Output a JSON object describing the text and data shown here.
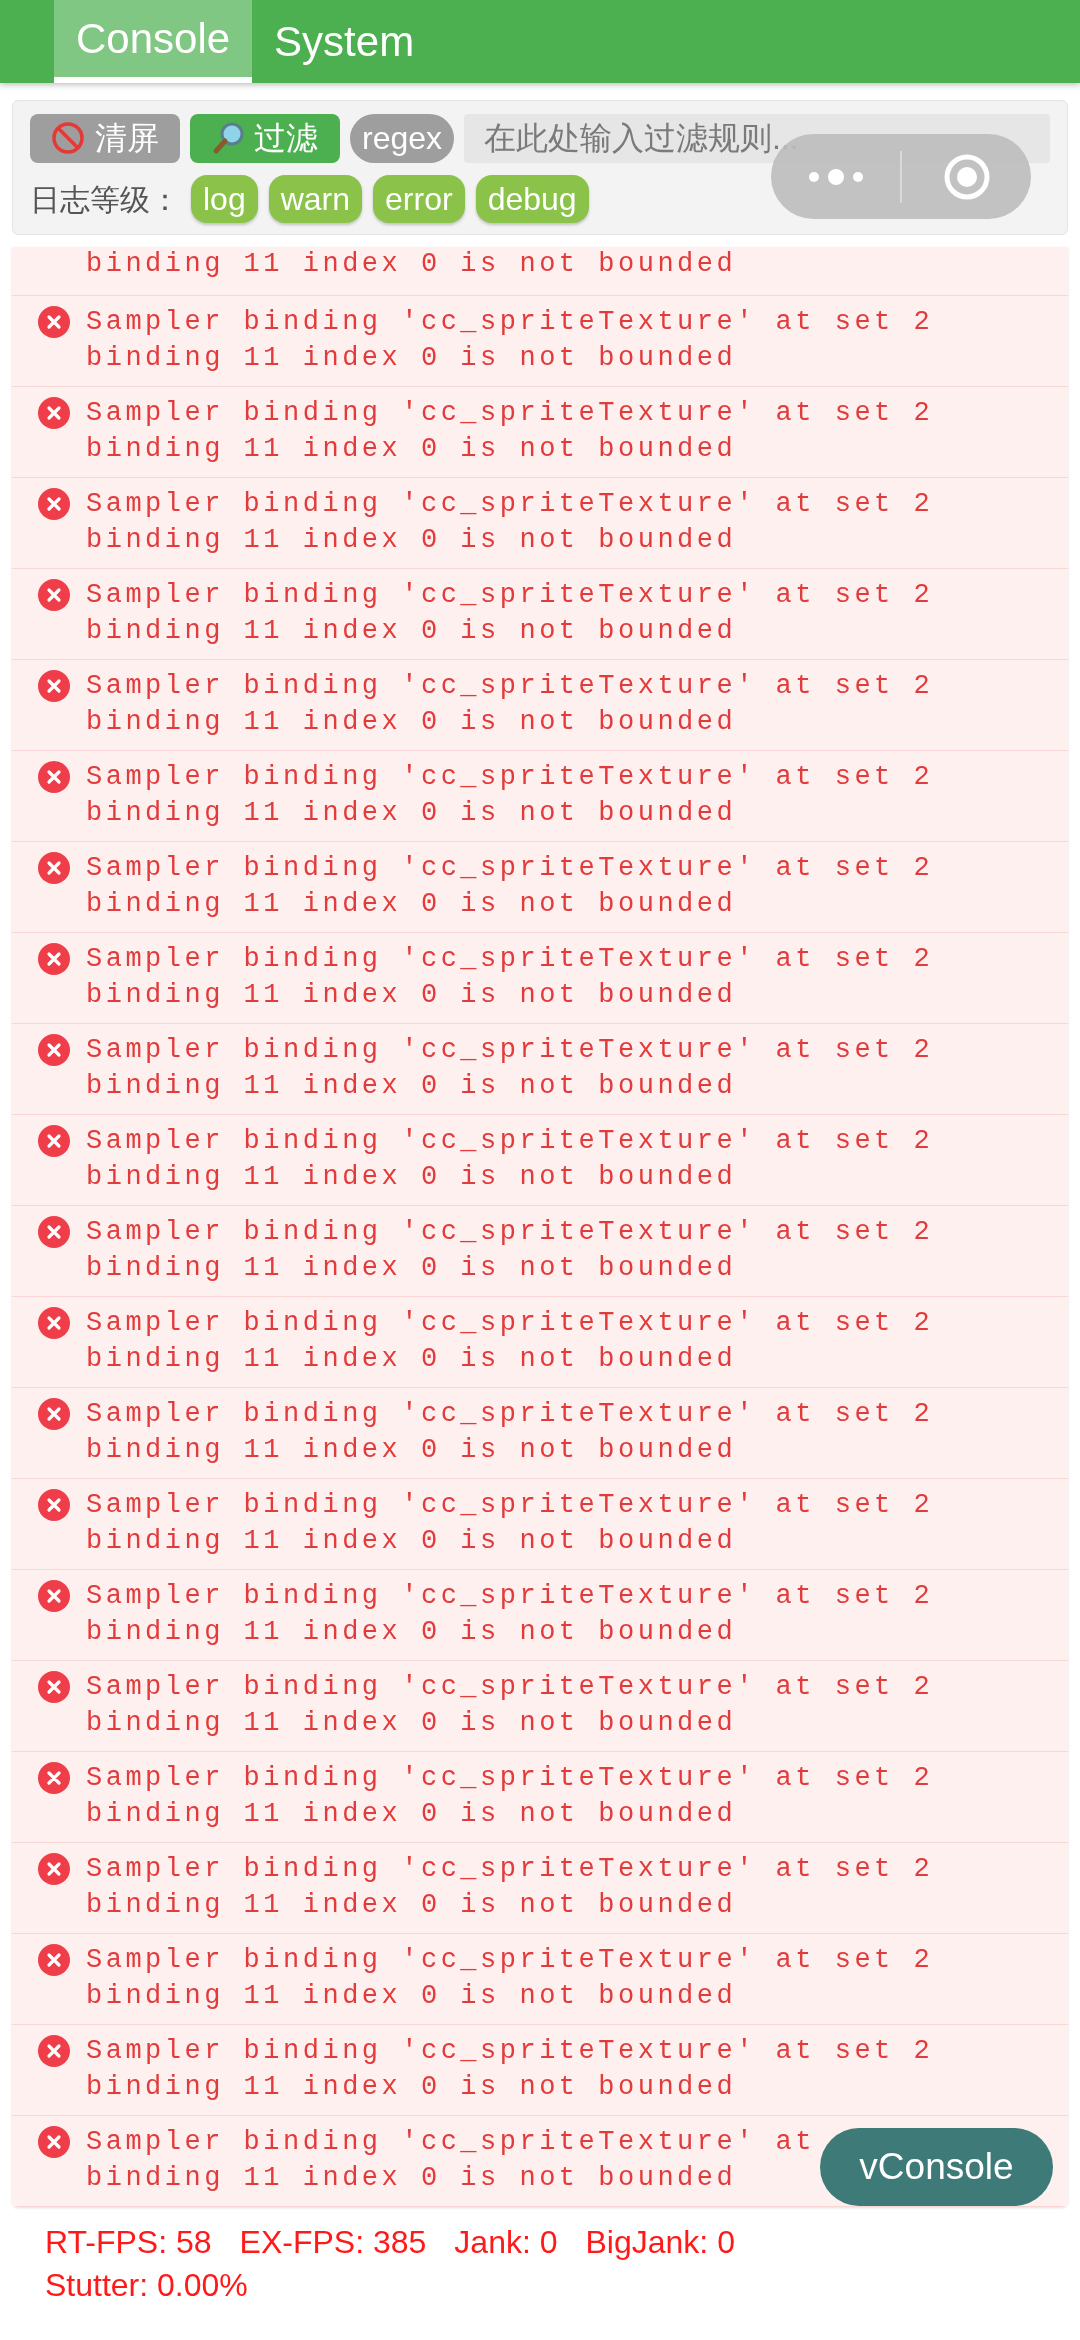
{
  "tabs": [
    {
      "label": "Console",
      "selected": true
    },
    {
      "label": "System",
      "selected": false
    }
  ],
  "toolbar": {
    "clear_button": "清屏",
    "filter_button": "过滤",
    "regex_button": "regex",
    "filter_field": {
      "placeholder": "在此处输入过滤规则..."
    },
    "level_label": "日志等级：",
    "levels": [
      {
        "label": "log"
      },
      {
        "label": "warn"
      },
      {
        "label": "error"
      },
      {
        "label": "debug"
      }
    ]
  },
  "logs": [
    {
      "kind": "fragment",
      "lines": [
        "binding 11 index 0 is not bounded"
      ]
    },
    {
      "kind": "error",
      "lines": [
        "Sampler binding 'cc_spriteTexture' at set 2",
        "binding 11 index 0 is not bounded"
      ]
    },
    {
      "kind": "error",
      "lines": [
        "Sampler binding 'cc_spriteTexture' at set 2",
        "binding 11 index 0 is not bounded"
      ]
    },
    {
      "kind": "error",
      "lines": [
        "Sampler binding 'cc_spriteTexture' at set 2",
        "binding 11 index 0 is not bounded"
      ]
    },
    {
      "kind": "error",
      "lines": [
        "Sampler binding 'cc_spriteTexture' at set 2",
        "binding 11 index 0 is not bounded"
      ]
    },
    {
      "kind": "error",
      "lines": [
        "Sampler binding 'cc_spriteTexture' at set 2",
        "binding 11 index 0 is not bounded"
      ]
    },
    {
      "kind": "error",
      "lines": [
        "Sampler binding 'cc_spriteTexture' at set 2",
        "binding 11 index 0 is not bounded"
      ]
    },
    {
      "kind": "error",
      "lines": [
        "Sampler binding 'cc_spriteTexture' at set 2",
        "binding 11 index 0 is not bounded"
      ]
    },
    {
      "kind": "error",
      "lines": [
        "Sampler binding 'cc_spriteTexture' at set 2",
        "binding 11 index 0 is not bounded"
      ]
    },
    {
      "kind": "error",
      "lines": [
        "Sampler binding 'cc_spriteTexture' at set 2",
        "binding 11 index 0 is not bounded"
      ]
    },
    {
      "kind": "error",
      "lines": [
        "Sampler binding 'cc_spriteTexture' at set 2",
        "binding 11 index 0 is not bounded"
      ]
    },
    {
      "kind": "error",
      "lines": [
        "Sampler binding 'cc_spriteTexture' at set 2",
        "binding 11 index 0 is not bounded"
      ]
    },
    {
      "kind": "error",
      "lines": [
        "Sampler binding 'cc_spriteTexture' at set 2",
        "binding 11 index 0 is not bounded"
      ]
    },
    {
      "kind": "error",
      "lines": [
        "Sampler binding 'cc_spriteTexture' at set 2",
        "binding 11 index 0 is not bounded"
      ]
    },
    {
      "kind": "error",
      "lines": [
        "Sampler binding 'cc_spriteTexture' at set 2",
        "binding 11 index 0 is not bounded"
      ]
    },
    {
      "kind": "error",
      "lines": [
        "Sampler binding 'cc_spriteTexture' at set 2",
        "binding 11 index 0 is not bounded"
      ]
    },
    {
      "kind": "error",
      "lines": [
        "Sampler binding 'cc_spriteTexture' at set 2",
        "binding 11 index 0 is not bounded"
      ]
    },
    {
      "kind": "error",
      "lines": [
        "Sampler binding 'cc_spriteTexture' at set 2",
        "binding 11 index 0 is not bounded"
      ]
    },
    {
      "kind": "error",
      "lines": [
        "Sampler binding 'cc_spriteTexture' at set 2",
        "binding 11 index 0 is not bounded"
      ]
    },
    {
      "kind": "error",
      "lines": [
        "Sampler binding 'cc_spriteTexture' at set 2",
        "binding 11 index 0 is not bounded"
      ]
    },
    {
      "kind": "error",
      "lines": [
        "Sampler binding 'cc_spriteTexture' at set 2",
        "binding 11 index 0 is not bounded"
      ]
    },
    {
      "kind": "error",
      "lines": [
        "Sampler binding 'cc_spriteTexture' at",
        "binding 11 index 0 is not bounded"
      ]
    }
  ],
  "stats_overlay": [
    "RT-FPS: 58",
    "EX-FPS: 385",
    "Jank: 0",
    "BigJank: 0",
    "Stutter: 0.00%"
  ],
  "vconsole_button": "vConsole"
}
